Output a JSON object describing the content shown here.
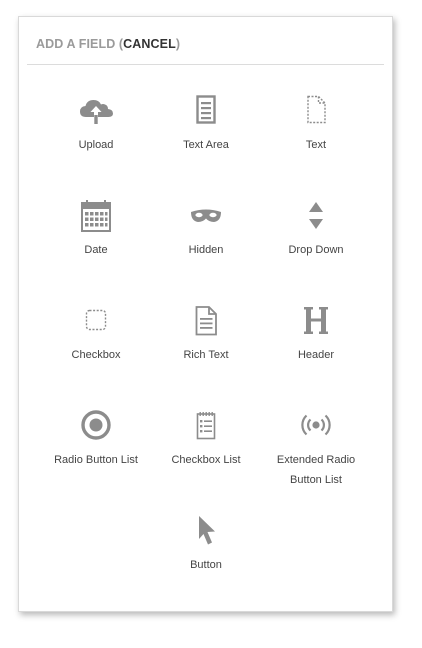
{
  "header": {
    "prefix": "ADD A FIELD (",
    "cancel": "CANCEL",
    "suffix": ")"
  },
  "fields": [
    {
      "label": "Upload",
      "icon": "cloud-upload-icon"
    },
    {
      "label": "Text Area",
      "icon": "text-area-icon"
    },
    {
      "label": "Text",
      "icon": "text-page-icon"
    },
    {
      "label": "Date",
      "icon": "calendar-icon"
    },
    {
      "label": "Hidden",
      "icon": "mask-icon"
    },
    {
      "label": "Drop Down",
      "icon": "up-down-arrows-icon"
    },
    {
      "label": "Checkbox",
      "icon": "dashed-square-icon"
    },
    {
      "label": "Rich Text",
      "icon": "document-icon"
    },
    {
      "label": "Header",
      "icon": "heading-h-icon"
    },
    {
      "label": "Radio Button List",
      "icon": "radio-button-icon"
    },
    {
      "label": "Checkbox List",
      "icon": "notepad-list-icon"
    },
    {
      "label": "Extended Radio\nButton List",
      "icon": "broadcast-icon"
    },
    {
      "label": "Button",
      "icon": "cursor-arrow-icon"
    }
  ],
  "colors": {
    "icon": "#8c8c8c",
    "label": "#444444",
    "header_muted": "#9a9a9a",
    "header_strong": "#333333"
  }
}
